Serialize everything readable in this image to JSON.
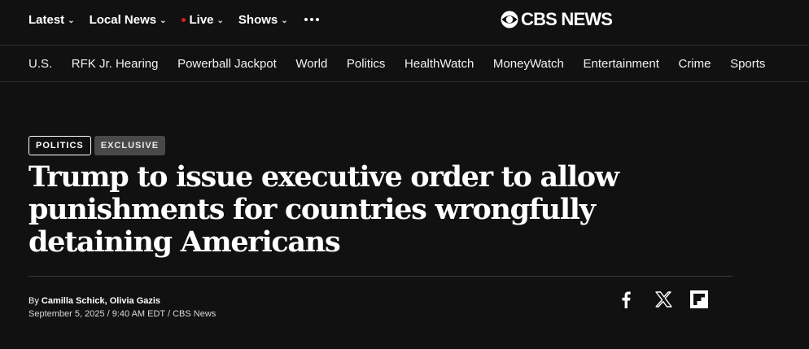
{
  "top_nav": {
    "items": [
      {
        "label": "Latest",
        "has_chevron": true
      },
      {
        "label": "Local News",
        "has_chevron": true
      },
      {
        "label": "Live",
        "has_chevron": true,
        "live_dot": true
      },
      {
        "label": "Shows",
        "has_chevron": true
      }
    ],
    "more_icon": "more-dots-icon",
    "live_dot_color": "#e21b23"
  },
  "logo": {
    "icon": "cbs-eye-icon",
    "text": "CBS NEWS"
  },
  "section_nav": {
    "items": [
      "U.S.",
      "RFK Jr. Hearing",
      "Powerball Jackpot",
      "World",
      "Politics",
      "HealthWatch",
      "MoneyWatch",
      "Entertainment",
      "Crime",
      "Sports"
    ]
  },
  "article": {
    "tags": [
      "POLITICS",
      "EXCLUSIVE"
    ],
    "headline_lines": [
      "Trump to issue executive order to allow",
      "punishments for countries wrongfully",
      "detaining Americans"
    ],
    "byline_prefix": "By ",
    "authors": [
      "Camilla Schick",
      "Olivia Gazis"
    ],
    "author_separator": ", ",
    "dateline": "September 5, 2025 / 9:40 AM EDT / CBS News"
  },
  "share": {
    "icons": [
      "facebook-icon",
      "x-icon",
      "flipboard-icon"
    ]
  },
  "colors": {
    "background": "#111111",
    "text": "#ffffff",
    "tag_exclusive_bg": "#494949",
    "live_dot": "#e21b23"
  }
}
